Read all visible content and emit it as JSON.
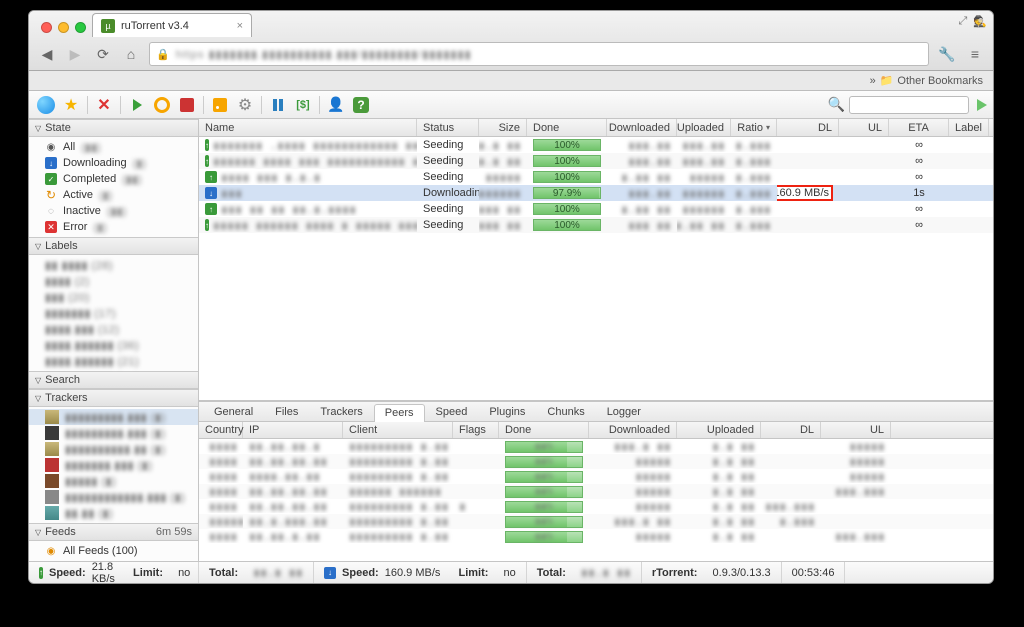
{
  "browser": {
    "tab_title": "ruTorrent v3.4",
    "addr_blur": "https ▮▮▮▮▮▮▮.▮▮▮▮▮▮▮▮▮▮.▮▮▮/▮▮▮▮▮▮▮▮/▮▮▮▮▮▮▮",
    "bookmarks_label": "Other Bookmarks"
  },
  "sidebar": {
    "state": {
      "header": "State",
      "items": [
        {
          "icon": "all",
          "label": "All",
          "count": "(▮▮)"
        },
        {
          "icon": "dl",
          "label": "Downloading",
          "count": "(▮)"
        },
        {
          "icon": "done",
          "label": "Completed",
          "count": "(▮▮)"
        },
        {
          "icon": "act",
          "label": "Active",
          "count": "(▮)"
        },
        {
          "icon": "inact",
          "label": "Inactive",
          "count": "(▮▮)"
        },
        {
          "icon": "err",
          "label": "Error",
          "count": "(▮)"
        }
      ]
    },
    "labels": {
      "header": "Labels",
      "items": [
        "▮▮ ▮▮▮▮ (28)",
        "▮▮▮▮ (2)",
        "▮▮▮ (20)",
        "▮▮▮▮▮▮▮ (17)",
        "▮▮▮▮.▮▮▮ (12)",
        "▮▮▮▮.▮▮▮▮▮▮ (36)",
        "▮▮▮▮.▮▮▮▮▮▮ (21)"
      ]
    },
    "search": {
      "header": "Search"
    },
    "trackers": {
      "header": "Trackers",
      "items": [
        {
          "cls": "a",
          "label": "▮▮▮▮▮▮▮▮▮.▮▮▮ (▮)",
          "sel": true
        },
        {
          "cls": "b",
          "label": "▮▮▮▮▮▮▮▮▮.▮▮▮ (▮)"
        },
        {
          "cls": "a",
          "label": "▮▮▮▮▮▮▮▮▮▮.▮▮ (▮)"
        },
        {
          "cls": "c",
          "label": "▮▮▮▮▮▮▮.▮▮▮ (▮)"
        },
        {
          "cls": "d",
          "label": "▮▮▮▮▮ (▮)"
        },
        {
          "cls": "e",
          "label": "▮▮▮▮▮▮▮▮▮▮▮▮.▮▮▮ (▮)"
        },
        {
          "cls": "f",
          "label": "▮▮.▮▮ (▮)"
        }
      ]
    },
    "feeds": {
      "header": "Feeds",
      "time": "6m 59s",
      "item": "All Feeds (100)"
    }
  },
  "columns": {
    "name": "Name",
    "status": "Status",
    "size": "Size",
    "done": "Done",
    "downloaded": "Downloaded",
    "uploaded": "Uploaded",
    "ratio": "Ratio",
    "dl": "DL",
    "ul": "UL",
    "eta": "ETA",
    "label": "Label"
  },
  "torrents": [
    {
      "icon": "seed",
      "name": "▮▮▮▮▮▮▮ .▮▮▮▮ ▮▮▮▮▮▮▮▮▮▮▮▮ ▮▮▮▮",
      "status": "Seeding",
      "size": "▮▮▮.▮ ▮▮",
      "done": "100%",
      "downloaded": "▮▮▮.▮▮",
      "uploaded": "▮▮▮.▮▮",
      "ratio": "▮.▮▮▮",
      "dl": "",
      "ul": "",
      "eta": "∞"
    },
    {
      "icon": "seed",
      "name": "▮▮▮▮▮▮ ▮▮▮▮ ▮▮▮ ▮▮▮▮▮▮▮▮▮▮▮ ▮.▮▮",
      "status": "Seeding",
      "size": "▮▮▮.▮ ▮▮",
      "done": "100%",
      "downloaded": "▮▮▮.▮▮",
      "uploaded": "▮▮▮.▮▮",
      "ratio": "▮.▮▮▮",
      "dl": "",
      "ul": "",
      "eta": "∞"
    },
    {
      "icon": "seed",
      "name": "▮▮▮▮ ▮▮▮ ▮.▮.▮",
      "status": "Seeding",
      "size": "▮▮▮▮▮",
      "done": "100%",
      "downloaded": "▮.▮▮ ▮▮",
      "uploaded": "▮▮▮▮▮",
      "ratio": "▮.▮▮▮",
      "dl": "",
      "ul": "",
      "eta": "∞"
    },
    {
      "icon": "down",
      "name": "▮▮▮",
      "status": "Downloading",
      "size": "▮▮▮▮▮▮▮",
      "done": "97.9%",
      "downloaded": "▮▮▮.▮▮",
      "uploaded": "▮▮▮▮▮▮",
      "ratio": "▮.▮▮▮",
      "dl": "160.9 MB/s",
      "ul": "",
      "eta": "1s",
      "selected": true,
      "hilite_dl": true,
      "partial": true
    },
    {
      "icon": "seed",
      "name": "▮▮▮ ▮▮ ▮▮ ▮▮.▮.▮▮▮▮",
      "status": "Seeding",
      "size": "▮▮▮ ▮▮",
      "done": "100%",
      "downloaded": "▮.▮▮ ▮▮",
      "uploaded": "▮▮▮▮▮▮",
      "ratio": "▮.▮▮▮",
      "dl": "",
      "ul": "",
      "eta": "∞"
    },
    {
      "icon": "seed",
      "name": "▮▮▮▮▮ ▮▮▮▮▮▮ ▮▮▮▮ ▮ ▮▮▮▮▮ ▮▮▮▮▮▮▮",
      "status": "Seeding",
      "size": "▮▮▮ ▮▮",
      "done": "100%",
      "downloaded": "▮▮▮ ▮▮",
      "uploaded": "▮.▮▮ ▮▮",
      "ratio": "▮.▮▮▮",
      "dl": "",
      "ul": "",
      "eta": "∞"
    }
  ],
  "detail_tabs": [
    "General",
    "Files",
    "Trackers",
    "Peers",
    "Speed",
    "Plugins",
    "Chunks",
    "Logger"
  ],
  "detail_active": "Peers",
  "peer_columns": {
    "country": "Country",
    "ip": "IP",
    "client": "Client",
    "flags": "Flags",
    "done": "Done",
    "downloaded": "Downloaded",
    "uploaded": "Uploaded",
    "dl": "DL",
    "ul": "UL"
  },
  "peers": [
    {
      "flag": "#3a9a3a",
      "ip": "▮▮▮▮",
      "ipz": "▮▮.▮▮.▮▮.▮",
      "client": "▮▮▮▮▮▮▮▮▮ ▮.▮▮",
      "done": "▮▮%",
      "downloaded": "▮▮▮.▮ ▮▮",
      "uploaded": "▮.▮ ▮▮",
      "dl": "",
      "ul": "▮▮▮▮▮"
    },
    {
      "flag": "#c33",
      "ip": "▮▮▮▮",
      "ipz": "▮▮.▮▮.▮▮.▮▮",
      "client": "▮▮▮▮▮▮▮▮▮ ▮.▮▮",
      "done": "▮▮%",
      "downloaded": "▮▮▮▮▮",
      "uploaded": "▮.▮ ▮▮",
      "dl": "",
      "ul": "▮▮▮▮▮"
    },
    {
      "flag": "#3a6ac9",
      "ip": "▮▮▮▮",
      "ipz": "▮▮▮▮.▮▮.▮▮",
      "client": "▮▮▮▮▮▮▮▮▮ ▮.▮▮",
      "done": "▮▮%",
      "downloaded": "▮▮▮▮▮",
      "uploaded": "▮.▮ ▮▮",
      "dl": "",
      "ul": "▮▮▮▮▮"
    },
    {
      "flag": "#9a7a3a",
      "ip": "▮▮▮▮",
      "ipz": "▮▮.▮▮.▮▮.▮▮",
      "client": "▮▮▮▮▮▮ ▮▮▮▮▮▮",
      "done": "▮▮%",
      "downloaded": "▮▮▮▮▮",
      "uploaded": "▮.▮ ▮▮",
      "dl": "",
      "ul": "▮▮▮.▮▮▮"
    },
    {
      "flag": "#c33",
      "ip": "▮▮▮▮",
      "ipz": "▮▮.▮▮.▮▮.▮▮",
      "client": "▮▮▮▮▮▮▮▮▮ ▮.▮▮",
      "flags": "▮",
      "done": "▮▮%",
      "downloaded": "▮▮▮▮▮",
      "uploaded": "▮.▮ ▮▮",
      "dl": "▮▮▮.▮▮▮",
      "ul": ""
    },
    {
      "flag": "#3a6ac9",
      "ip": "▮▮▮▮▮",
      "ipz": "▮▮.▮.▮▮▮.▮▮",
      "client": "▮▮▮▮▮▮▮▮▮ ▮.▮▮",
      "done": "▮▮%",
      "downloaded": "▮▮▮.▮ ▮▮",
      "uploaded": "▮.▮ ▮▮",
      "dl": "▮.▮▮▮",
      "ul": ""
    },
    {
      "flag": "#888",
      "ip": "▮▮▮▮",
      "ipz": "▮▮.▮▮.▮.▮▮",
      "client": "▮▮▮▮▮▮▮▮▮ ▮.▮▮",
      "done": "▮▮%",
      "downloaded": "▮▮▮▮▮",
      "uploaded": "▮.▮ ▮▮",
      "dl": "",
      "ul": "▮▮▮.▮▮▮"
    }
  ],
  "statusbar": {
    "up_speed_label": "Speed:",
    "up_speed": "21.8 KB/s",
    "up_limit_label": "Limit:",
    "up_limit": "no",
    "up_total_label": "Total:",
    "up_total": "▮▮.▮ ▮▮",
    "dn_speed_label": "Speed:",
    "dn_speed": "160.9 MB/s",
    "dn_limit_label": "Limit:",
    "dn_limit": "no",
    "dn_total_label": "Total:",
    "dn_total": "▮▮.▮ ▮▮",
    "rtorrent_label": "rTorrent:",
    "rtorrent": "0.9.3/0.13.3",
    "uptime": "00:53:46"
  }
}
